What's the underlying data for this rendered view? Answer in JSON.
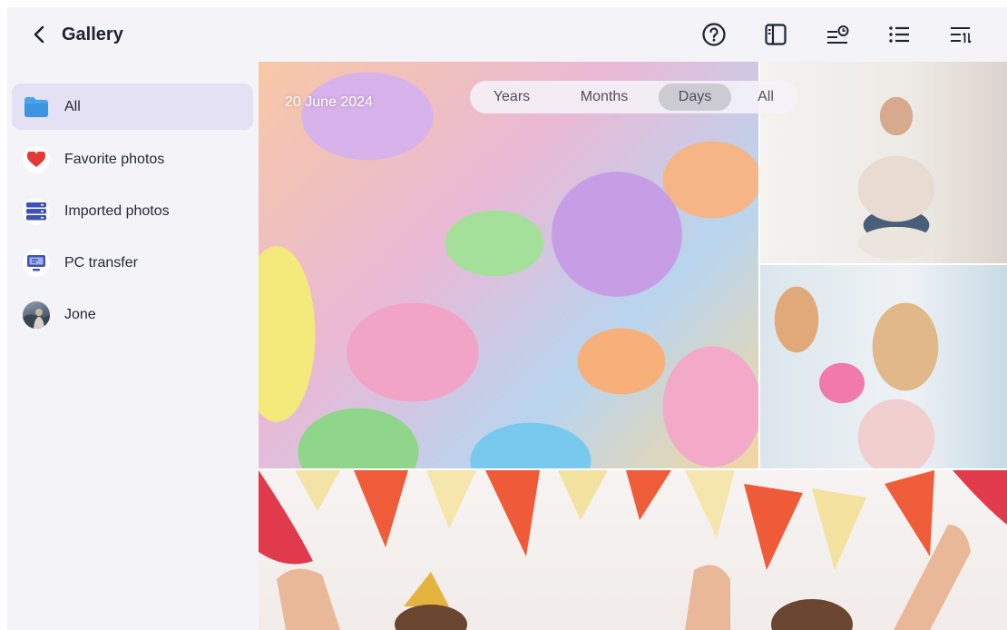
{
  "header": {
    "title": "Gallery",
    "icons": [
      "back-arrow-icon",
      "help-icon",
      "side-panel-icon",
      "timeline-filter-icon",
      "list-view-icon",
      "sort-icon"
    ]
  },
  "sidebar": {
    "items": [
      {
        "label": "All",
        "icon": "folder-icon",
        "active": true
      },
      {
        "label": "Favorite photos",
        "icon": "heart-icon",
        "active": false
      },
      {
        "label": "Imported photos",
        "icon": "database-icon",
        "active": false
      },
      {
        "label": "PC transfer",
        "icon": "monitor-icon",
        "active": false
      },
      {
        "label": "Jone",
        "icon": "avatar",
        "active": false
      }
    ]
  },
  "view": {
    "date": "20 June 2024",
    "segments": [
      "Years",
      "Months",
      "Days",
      "All"
    ],
    "active_segment": "Days"
  },
  "colors": {
    "accent": "#4b57c9",
    "active_bg": "#e3e1f3",
    "heart": "#e53935",
    "folder": "#4aa3ee",
    "header_bg": "#f3f3f8"
  }
}
